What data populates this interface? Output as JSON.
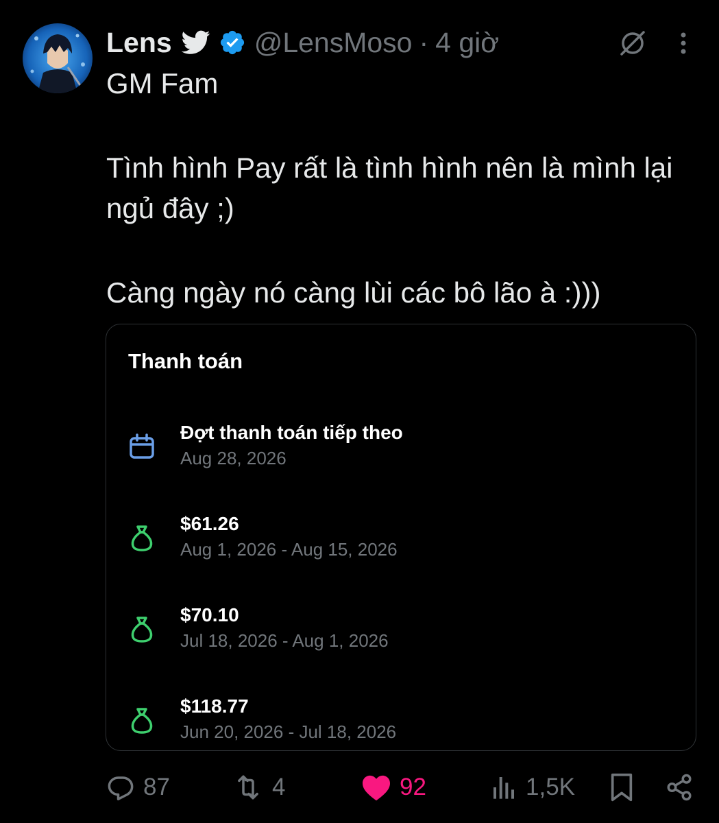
{
  "author": {
    "name": "Lens",
    "handle": "@LensMoso",
    "separator": "·",
    "time": "4 giờ",
    "avatar": "avatar-image",
    "bird_icon": "twitter-bird-icon",
    "verified_icon": "verified-badge-icon",
    "verified_color": "#1d9bf0"
  },
  "header_actions": {
    "grok_icon": "grok-icon",
    "more_icon": "more-vertical-icon"
  },
  "tweet": {
    "paragraphs": [
      "GM Fam",
      "Tình hình Pay rất là tình hình nên là mình lại ngủ đây ;)",
      "Càng ngày nó càng lùi các bô lão à :)))"
    ]
  },
  "card": {
    "title": "Thanh toán",
    "rows": [
      {
        "icon": "calendar-icon",
        "label": "Đợt thanh toán tiếp theo",
        "sub": "Aug 28, 2026",
        "color": "#6b9fe8"
      },
      {
        "icon": "money-bag-icon",
        "label": "$61.26",
        "sub": "Aug 1, 2026 - Aug 15, 2026",
        "color": "#3ecf6e"
      },
      {
        "icon": "money-bag-icon",
        "label": "$70.10",
        "sub": "Jul 18, 2026 - Aug 1, 2026",
        "color": "#3ecf6e"
      },
      {
        "icon": "money-bag-icon",
        "label": "$118.77",
        "sub": "Jun 20, 2026 - Jul 18, 2026",
        "color": "#3ecf6e"
      }
    ]
  },
  "actions": {
    "replies": {
      "icon": "reply-icon",
      "count": "87"
    },
    "reposts": {
      "icon": "repost-icon",
      "count": "4"
    },
    "likes": {
      "icon": "heart-icon",
      "count": "92",
      "color": "#f91880"
    },
    "views": {
      "icon": "views-icon",
      "count": "1,5K"
    },
    "bookmark": {
      "icon": "bookmark-icon"
    },
    "share": {
      "icon": "share-icon"
    }
  },
  "colors": {
    "background": "#000000",
    "text": "#e7e9ea",
    "muted": "#71767b",
    "border": "#2f3336"
  }
}
